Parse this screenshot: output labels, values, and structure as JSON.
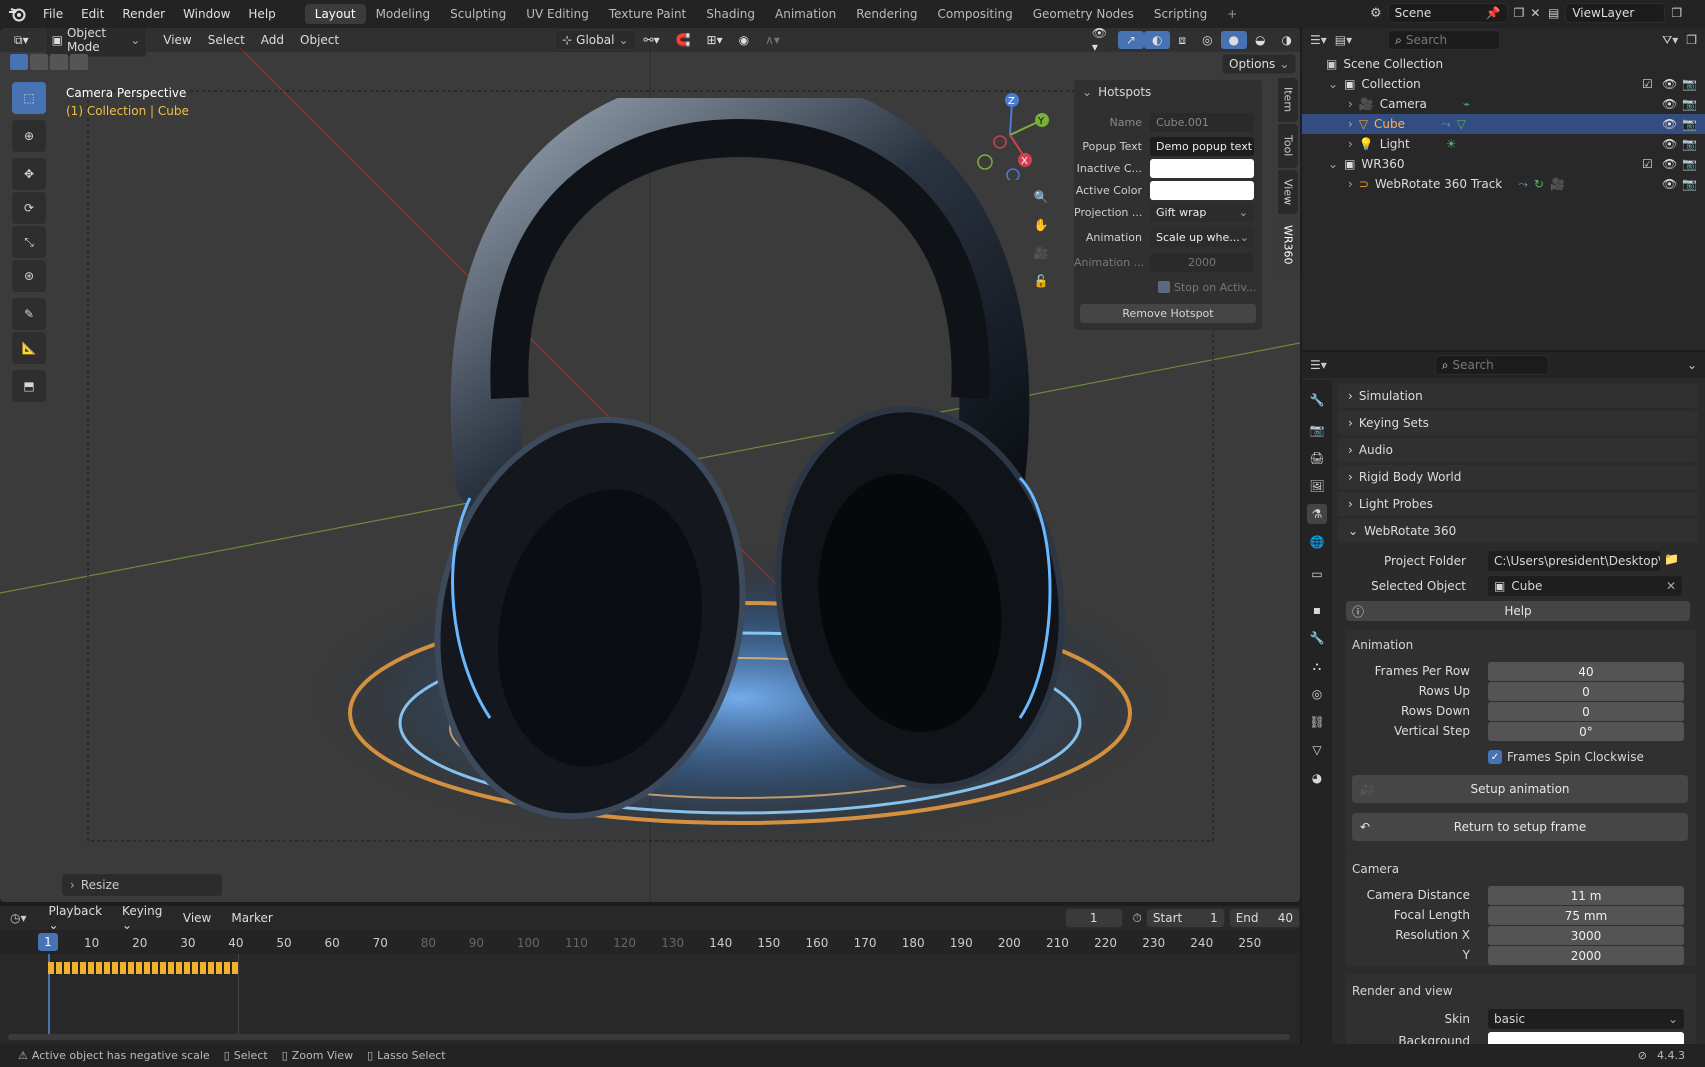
{
  "topbar": {
    "menus": [
      "File",
      "Edit",
      "Render",
      "Window",
      "Help"
    ],
    "workspaces": [
      "Layout",
      "Modeling",
      "Sculpting",
      "UV Editing",
      "Texture Paint",
      "Shading",
      "Animation",
      "Rendering",
      "Compositing",
      "Geometry Nodes",
      "Scripting"
    ],
    "active_workspace": "Layout",
    "scene": "Scene",
    "view_layer": "ViewLayer"
  },
  "viewport": {
    "mode": "Object Mode",
    "menus": [
      "View",
      "Select",
      "Add",
      "Object"
    ],
    "orientation": "Global",
    "options_label": "Options",
    "camera_label": "Camera Perspective",
    "collection_label": "(1) Collection | Cube",
    "resize_label": "Resize",
    "gizmo_axes": [
      "Z",
      "Y",
      "X"
    ]
  },
  "hotspots": {
    "title": "Hotspots",
    "name_label": "Name",
    "name_value": "Cube.001",
    "popup_label": "Popup Text",
    "popup_value": "Demo popup text",
    "inactive_label": "Inactive C...",
    "active_label": "Active Color",
    "projection_label": "Projection ...",
    "projection_value": "Gift wrap",
    "animation_label": "Animation",
    "animation_value": "Scale up whe...",
    "anim2_label": "Animation ...",
    "anim2_value": "2000",
    "stop_label": "Stop on Activ...",
    "remove_label": "Remove Hotspot",
    "side_tabs": [
      "Item",
      "Tool",
      "View",
      "WR360"
    ]
  },
  "outliner": {
    "search_placeholder": "Search",
    "items": [
      {
        "label": "Scene Collection"
      },
      {
        "label": "Collection"
      },
      {
        "label": "Camera"
      },
      {
        "label": "Cube"
      },
      {
        "label": "Light"
      },
      {
        "label": "WR360"
      },
      {
        "label": "WebRotate 360 Track"
      }
    ]
  },
  "properties": {
    "search_placeholder": "Search",
    "sections": [
      "Simulation",
      "Keying Sets",
      "Audio",
      "Rigid Body World",
      "Light Probes",
      "WebRotate 360"
    ],
    "project_folder_label": "Project Folder",
    "project_folder_value": "C:\\Users\\president\\Desktop\\T...",
    "selected_object_label": "Selected Object",
    "selected_object_value": "Cube",
    "help_label": "Help",
    "animation_header": "Animation",
    "frames_per_row_label": "Frames Per Row",
    "frames_per_row": "40",
    "rows_up_label": "Rows Up",
    "rows_up": "0",
    "rows_down_label": "Rows Down",
    "rows_down": "0",
    "vertical_step_label": "Vertical Step",
    "vertical_step": "0°",
    "spin_label": "Frames Spin Clockwise",
    "setup_label": "Setup animation",
    "return_label": "Return to setup frame",
    "camera_header": "Camera",
    "cam_distance_label": "Camera Distance",
    "cam_distance": "11 m",
    "focal_label": "Focal Length",
    "focal": "75 mm",
    "resx_label": "Resolution X",
    "resx": "3000",
    "resy_label": "Y",
    "resy": "2000",
    "render_header": "Render and view",
    "skin_label": "Skin",
    "skin": "basic",
    "background_label": "Background"
  },
  "timeline": {
    "menus": [
      "Playback",
      "Keying",
      "View",
      "Marker"
    ],
    "current_frame": "1",
    "start_label": "Start",
    "start": "1",
    "end_label": "End",
    "end": "40",
    "ticks": [
      "10",
      "20",
      "30",
      "40",
      "50",
      "60",
      "70",
      "80",
      "90",
      "100",
      "110",
      "120",
      "130",
      "140",
      "150",
      "160",
      "170",
      "180",
      "190",
      "200",
      "210",
      "220",
      "230",
      "240",
      "250"
    ]
  },
  "statusbar": {
    "warning": "Active object has negative scale",
    "select": "Select",
    "zoom": "Zoom View",
    "lasso": "Lasso Select",
    "version": "4.4.3"
  }
}
